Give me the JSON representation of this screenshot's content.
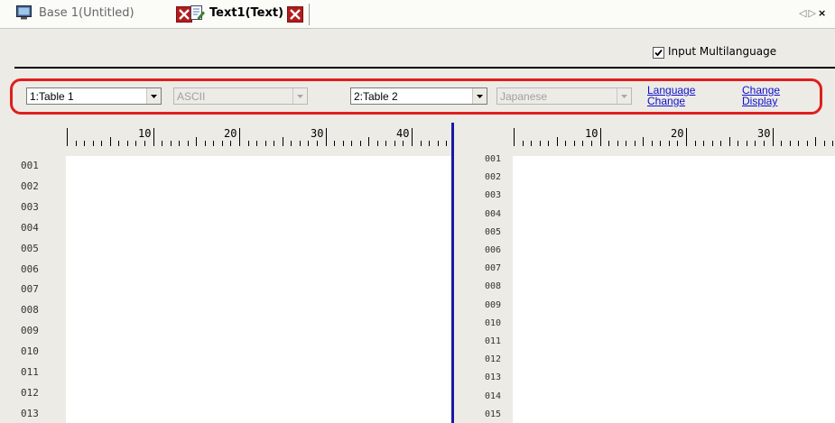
{
  "tabs": [
    {
      "label": "Base 1(Untitled)",
      "icon": "base-screen-icon",
      "close_icon": "close-icon"
    },
    {
      "label": "Text1(Text)",
      "icon": "text-file-icon",
      "close_icon": "close-icon",
      "active": true
    }
  ],
  "tab_nav": {
    "prev": "◁",
    "next": "▷",
    "close": "×"
  },
  "options": {
    "input_multilanguage_label": "Input Multilanguage",
    "input_multilanguage_checked": true
  },
  "left_pane": {
    "table_select": "1:Table 1",
    "encoding_select": "ASCII",
    "encoding_disabled": true
  },
  "right_pane": {
    "table_select": "2:Table 2",
    "encoding_select": "Japanese",
    "encoding_disabled": true
  },
  "links": {
    "language_change": [
      "Language",
      "Change"
    ],
    "change_display": [
      "Change",
      "Display"
    ]
  },
  "ruler": {
    "labels": [
      "10",
      "20",
      "30",
      "40"
    ]
  },
  "left_line_numbers": [
    "001",
    "002",
    "003",
    "004",
    "005",
    "006",
    "007",
    "008",
    "009",
    "010",
    "011",
    "012",
    "013"
  ],
  "right_line_numbers": [
    "001",
    "002",
    "003",
    "004",
    "005",
    "006",
    "007",
    "008",
    "009",
    "010",
    "011",
    "012",
    "013",
    "014",
    "015"
  ],
  "colors": {
    "highlight": "#e01e1e",
    "divider": "#1a1aa0",
    "link": "#1010cc",
    "close_button": "#b21c1c"
  }
}
